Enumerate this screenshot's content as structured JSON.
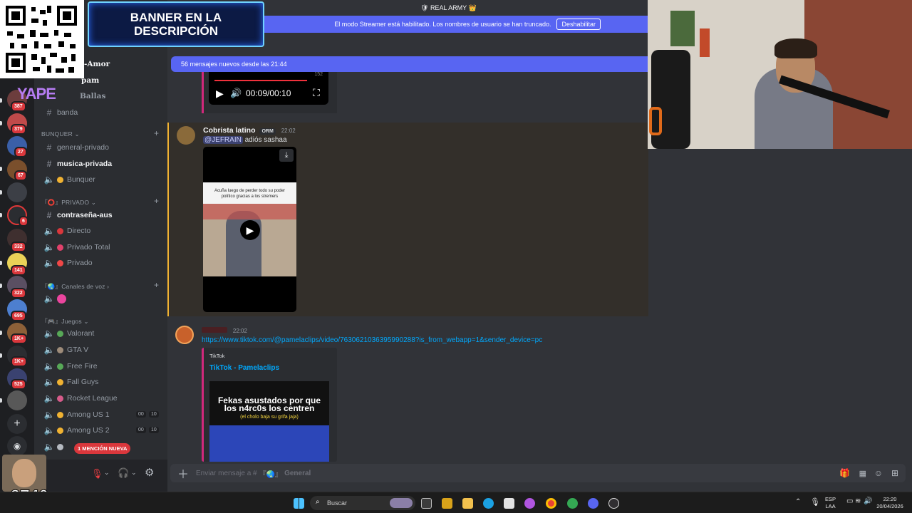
{
  "window": {
    "title": "REAL ARMY"
  },
  "streamer_bar": {
    "text": "El modo Streamer está habilitado. Los nombres de usuario se han truncado.",
    "button": "Deshabilitar"
  },
  "new_messages": "56 mensajes nuevos desde las 21:44",
  "overlay": {
    "banner": "BANNER EN LA DESCRIPCIÓN",
    "yape": "YAPE",
    "counter": "x2749"
  },
  "rail_badges": [
    "387",
    "379",
    "27",
    "67",
    "6",
    "332",
    "141",
    "322",
    "695",
    "1K+",
    "1K+",
    "525"
  ],
  "sidebar": {
    "top_channels": [
      {
        "label": "l-Amor"
      },
      {
        "label": "pam"
      },
      {
        "label": "Ballas"
      },
      {
        "label": "banda"
      }
    ],
    "cat_bunquer": "BUNQUER",
    "bunquer_channels": [
      {
        "label": "general-privado"
      },
      {
        "label": "musica-privada"
      },
      {
        "label": "Bunquer"
      }
    ],
    "cat_privado": "PRIVADO",
    "privado_channels": [
      {
        "label": "contraseña-aus"
      },
      {
        "label": "Directo"
      },
      {
        "label": "Privado Total"
      },
      {
        "label": "Privado"
      }
    ],
    "cat_voz": "Canales de voz",
    "cat_juegos": "Juegos",
    "juegos_channels": [
      {
        "label": "Valorant"
      },
      {
        "label": "GTA V"
      },
      {
        "label": "Free Fire"
      },
      {
        "label": "Fall Guys"
      },
      {
        "label": "Rocket League"
      },
      {
        "label": "Among US 1",
        "count": "00",
        "max": "10"
      },
      {
        "label": "Among US 2",
        "count": "00",
        "max": "10"
      }
    ],
    "mention_badge": "1 MENCIÓN NUEVA"
  },
  "chat": {
    "audio": {
      "time": "00:09/00:10",
      "tiny": "152"
    },
    "msg1": {
      "author": "Cobrista latino",
      "tag": "ORM",
      "time": "22:02",
      "mention": "@JEFRAIN",
      "text": "adiós sashaa",
      "video_caption": "Acuña luego de perder todo su poder político gracias a los stremers"
    },
    "msg2": {
      "time": "22:02",
      "link": "https://www.tiktok.com/@pamelaclips/video/7630621036395990288?is_from_webapp=1&sender_device=pc",
      "embed_provider": "TikTok",
      "embed_title": "TikTok - Pamelaclips",
      "thumb_text": "Fekas asustados por que los n4rc0s los centren",
      "thumb_sub": "(el cholo baja su grifa jaja)"
    },
    "input_placeholder": "Enviar mensaje a #",
    "input_channel": "General"
  },
  "taskbar": {
    "search": "Buscar",
    "lang1": "ESP",
    "lang2": "LAA",
    "time": "22:20",
    "date": "20/04/2026"
  },
  "colors": {
    "blurple": "#5865f2",
    "red": "#da373c",
    "link": "#00a8fc"
  }
}
